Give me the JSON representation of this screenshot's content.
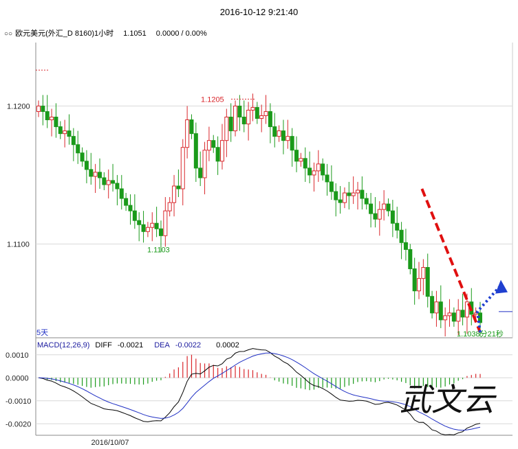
{
  "header": {
    "timestamp": "2016-10-12 9:21:40",
    "symbol": "欧元美元(外汇_D 8160)1小时",
    "price": "1.1051",
    "change": "0.0000 / 0.00%"
  },
  "chart_data": [
    {
      "type": "candlestick",
      "title": "欧元美元(外汇_D 8160)1小时",
      "y_ticks": [
        "1.1200",
        "1.1100"
      ],
      "ylim": [
        1.1032,
        1.1246
      ],
      "annotations": {
        "high_label": "1.1205",
        "low_label": "1.1103",
        "period_label": "5天",
        "countdown_label": "1.1038分21秒"
      },
      "ohlc_close": [
        1.12,
        1.1196,
        1.119,
        1.1192,
        1.1185,
        1.118,
        1.1182,
        1.1178,
        1.1172,
        1.1166,
        1.116,
        1.1154,
        1.1149,
        1.1152,
        1.1148,
        1.1143,
        1.1146,
        1.1144,
        1.114,
        1.1133,
        1.1128,
        1.1124,
        1.1117,
        1.1114,
        1.1109,
        1.1112,
        1.1115,
        1.1111,
        1.1106,
        1.1124,
        1.113,
        1.1142,
        1.114,
        1.117,
        1.119,
        1.118,
        1.1155,
        1.1148,
        1.1168,
        1.1175,
        1.117,
        1.116,
        1.1175,
        1.1192,
        1.1182,
        1.12,
        1.1192,
        1.1187,
        1.1197,
        1.1199,
        1.1191,
        1.1193,
        1.1196,
        1.1185,
        1.1178,
        1.1182,
        1.1175,
        1.1178,
        1.1168,
        1.116,
        1.1162,
        1.1155,
        1.115,
        1.1153,
        1.1158,
        1.115,
        1.1145,
        1.1138,
        1.1132,
        1.113,
        1.1137,
        1.1135,
        1.1137,
        1.1139,
        1.1133,
        1.1129,
        1.1122,
        1.1118,
        1.1125,
        1.1129,
        1.1124,
        1.1115,
        1.111,
        1.1101,
        1.1096,
        1.1082,
        1.1066,
        1.1075,
        1.1083,
        1.1062,
        1.105,
        1.1058,
        1.1045,
        1.1048,
        1.105,
        1.1044,
        1.1052,
        1.1047,
        1.1058,
        1.1049,
        1.105,
        1.1043
      ],
      "macd": {
        "params": "MACD(12,26,9)",
        "diff_label": "DIFF",
        "diff_value": "-0.0021",
        "dea_label": "DEA",
        "dea_value": "-0.0022",
        "macd_value": "0.0002",
        "y_ticks": [
          "0.0010",
          "0.0000",
          "-0.0010",
          "-0.0020"
        ],
        "ylim": [
          -0.0025,
          0.0015
        ]
      },
      "x_ticks": [
        "2016/10/07"
      ],
      "colors": {
        "up": "#d9262b",
        "down": "#1a9a1a",
        "diff": "#000000",
        "dea": "#1f2fc4",
        "trend": "#e01010",
        "projection": "#1f3fd0"
      }
    }
  ],
  "watermark": "武文云"
}
